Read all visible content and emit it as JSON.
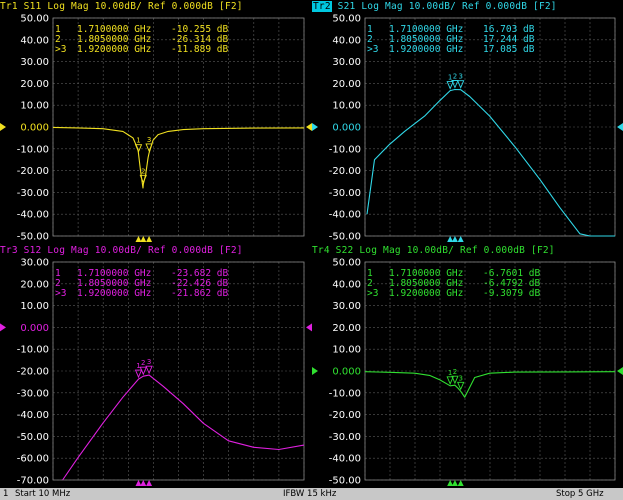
{
  "traces": [
    {
      "id": "tr1",
      "title": "Tr1 S11 Log Mag 10.00dB/ Ref 0.000dB [F2]",
      "color": "#f0e020",
      "yticks": [
        "50.00",
        "40.00",
        "30.00",
        "20.00",
        "10.00",
        "0.000",
        "-10.00",
        "-20.00",
        "-30.00",
        "-40.00",
        "-50.00"
      ],
      "markers": [
        {
          "id": "1",
          "freq": "1.7100000 GHz",
          "value": "-10.255 dB"
        },
        {
          "id": "2",
          "freq": "1.8050000 GHz",
          "value": "-26.314 dB"
        },
        {
          "id": ">3",
          "freq": "1.9200000 GHz",
          "value": "-11.889 dB"
        }
      ]
    },
    {
      "id": "tr2",
      "title": "Tr2 S21 Log Mag 10.00dB/ Ref 0.000dB [F2]",
      "color": "#30d8e8",
      "yticks": [
        "50.00",
        "40.00",
        "30.00",
        "20.00",
        "10.00",
        "0.000",
        "-10.00",
        "-20.00",
        "-30.00",
        "-40.00",
        "-50.00"
      ],
      "markers": [
        {
          "id": "1",
          "freq": "1.7100000 GHz",
          "value": "16.703 dB"
        },
        {
          "id": "2",
          "freq": "1.8050000 GHz",
          "value": "17.244 dB"
        },
        {
          "id": ">3",
          "freq": "1.9200000 GHz",
          "value": "17.085 dB"
        }
      ]
    },
    {
      "id": "tr3",
      "title": "Tr3 S12 Log Mag 10.00dB/ Ref 0.000dB [F2]",
      "color": "#e020e0",
      "yticks": [
        "30.00",
        "20.00",
        "10.00",
        "0.000",
        "-10.00",
        "-20.00",
        "-30.00",
        "-40.00",
        "-50.00",
        "-60.00",
        "-70.00"
      ],
      "markers": [
        {
          "id": "1",
          "freq": "1.7100000 GHz",
          "value": "-23.682 dB"
        },
        {
          "id": "2",
          "freq": "1.8050000 GHz",
          "value": "-22.426 dB"
        },
        {
          "id": ">3",
          "freq": "1.9200000 GHz",
          "value": "-21.862 dB"
        }
      ]
    },
    {
      "id": "tr4",
      "title": "Tr4 S22 Log Mag 10.00dB/ Ref 0.000dB [F2]",
      "color": "#30e030",
      "yticks": [
        "50.00",
        "40.00",
        "30.00",
        "20.00",
        "10.00",
        "0.000",
        "-10.00",
        "-20.00",
        "-30.00",
        "-40.00",
        "-50.00"
      ],
      "markers": [
        {
          "id": "1",
          "freq": "1.7100000 GHz",
          "value": "-6.7601 dB"
        },
        {
          "id": "2",
          "freq": "1.8050000 GHz",
          "value": "-6.4792 dB"
        },
        {
          "id": ">3",
          "freq": "1.9200000 GHz",
          "value": "-9.3079 dB"
        }
      ]
    }
  ],
  "status": {
    "channel": "1",
    "start": "Start 10 MHz",
    "ifbw": "IFBW 15 kHz",
    "stop": "Stop 5 GHz"
  },
  "chart_data": [
    {
      "type": "line",
      "title": "Tr1 S11 Log Mag 10.00dB/ Ref 0.000dB [F2]",
      "xlim": [
        0.01,
        5
      ],
      "ylim": [
        -50,
        50
      ],
      "series": [
        {
          "name": "S11",
          "x": [
            0.01,
            0.5,
            1.0,
            1.4,
            1.6,
            1.7,
            1.75,
            1.8,
            1.805,
            1.85,
            1.9,
            1.92,
            2.0,
            2.1,
            2.3,
            2.6,
            3.0,
            4.0,
            5.0
          ],
          "values": [
            -0.2,
            -0.4,
            -0.8,
            -2,
            -5,
            -10.3,
            -20,
            -28,
            -26.3,
            -22,
            -14,
            -11.9,
            -6,
            -3.5,
            -2,
            -1.2,
            -0.8,
            -0.5,
            -0.4
          ]
        }
      ]
    },
    {
      "type": "line",
      "title": "Tr2 S21 Log Mag 10.00dB/ Ref 0.000dB [F2]",
      "xlim": [
        0.01,
        5
      ],
      "ylim": [
        -50,
        50
      ],
      "series": [
        {
          "name": "S21",
          "x": [
            0.05,
            0.2,
            0.5,
            0.8,
            1.2,
            1.5,
            1.71,
            1.805,
            1.92,
            2.1,
            2.5,
            3.0,
            3.5,
            3.9,
            4.3,
            4.5,
            5.0
          ],
          "values": [
            -40,
            -15,
            -8,
            -2,
            5,
            12,
            16.7,
            17.2,
            17.1,
            14,
            5,
            -9,
            -24,
            -37,
            -49,
            -50,
            -50
          ]
        }
      ]
    },
    {
      "type": "line",
      "title": "Tr3 S12 Log Mag 10.00dB/ Ref 0.000dB [F2]",
      "xlim": [
        0.01,
        5
      ],
      "ylim": [
        -70,
        30
      ],
      "series": [
        {
          "name": "S12",
          "x": [
            0.2,
            0.5,
            1.0,
            1.4,
            1.71,
            1.805,
            1.92,
            2.2,
            2.6,
            3.0,
            3.5,
            4.0,
            4.5,
            5.0
          ],
          "values": [
            -70,
            -60,
            -44,
            -32,
            -23.7,
            -22.4,
            -21.9,
            -27,
            -35,
            -44,
            -52,
            -55,
            -56,
            -54
          ]
        }
      ]
    },
    {
      "type": "line",
      "title": "Tr4 S22 Log Mag 10.00dB/ Ref 0.000dB [F2]",
      "xlim": [
        0.01,
        5
      ],
      "ylim": [
        -50,
        50
      ],
      "series": [
        {
          "name": "S22",
          "x": [
            0.01,
            0.5,
            1.0,
            1.3,
            1.5,
            1.71,
            1.805,
            1.87,
            1.92,
            2.0,
            2.2,
            2.5,
            3.0,
            4.0,
            5.0
          ],
          "values": [
            -0.3,
            -0.6,
            -1,
            -2,
            -4,
            -6.8,
            -6.5,
            -8,
            -9.3,
            -12,
            -3,
            -1,
            -0.5,
            -0.4,
            -0.3
          ]
        }
      ]
    }
  ]
}
